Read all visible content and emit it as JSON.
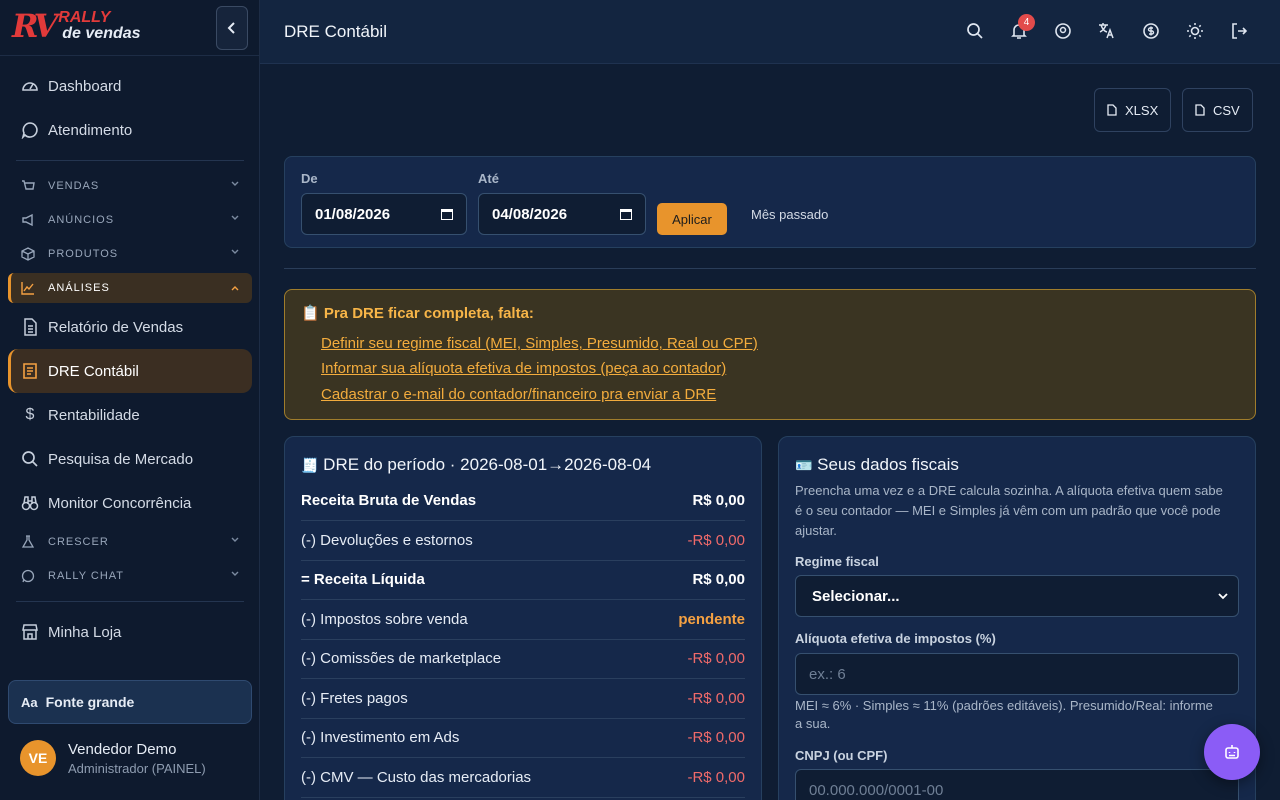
{
  "brand": {
    "mark": "RV",
    "line1": "RALLY",
    "line2": "de vendas",
    "accent": "#e23a3a"
  },
  "sidebar": {
    "top_items": [
      {
        "label": "Dashboard",
        "icon": "gauge-icon"
      },
      {
        "label": "Atendimento",
        "icon": "chat-bubble-icon"
      }
    ],
    "sections": [
      {
        "label": "VENDAS",
        "icon": "cart-icon"
      },
      {
        "label": "ANÚNCIOS",
        "icon": "megaphone-icon"
      },
      {
        "label": "PRODUTOS",
        "icon": "box-icon"
      },
      {
        "label": "ANÁLISES",
        "icon": "chart-line-icon",
        "expanded": true
      }
    ],
    "analysis_items": [
      {
        "label": "Relatório de Vendas",
        "icon": "document-icon"
      },
      {
        "label": "DRE Contábil",
        "icon": "receipt-icon",
        "active": true
      },
      {
        "label": "Rentabilidade",
        "icon": "dollar-icon"
      },
      {
        "label": "Pesquisa de Mercado",
        "icon": "search-icon"
      },
      {
        "label": "Monitor Concorrência",
        "icon": "binoculars-icon"
      }
    ],
    "sections2": [
      {
        "label": "CRESCER",
        "icon": "flask-icon"
      },
      {
        "label": "RALLY CHAT",
        "icon": "whatsapp-icon"
      }
    ],
    "store_item": {
      "label": "Minha Loja",
      "icon": "store-icon"
    },
    "font_toggle": "Fonte grande",
    "font_toggle_icon": "Aa",
    "user": {
      "initials": "VE",
      "name": "Vendedor Demo",
      "role": "Administrador (PAINEL)"
    }
  },
  "header": {
    "title": "DRE Contábil",
    "notification_count": "4",
    "icons": [
      "search-icon",
      "bell-icon",
      "user-circle-icon",
      "translate-icon",
      "currency-icon",
      "sun-icon",
      "logout-icon"
    ]
  },
  "toolbar": {
    "xlsx": "XLSX",
    "csv": "CSV"
  },
  "filter": {
    "from_label": "De",
    "from_value": "01/08/2026",
    "to_label": "Até",
    "to_value": "04/08/2026",
    "apply": "Aplicar",
    "preset": "Mês passado"
  },
  "warning": {
    "title": "📋 Pra DRE ficar completa, falta:",
    "links": [
      "Definir seu regime fiscal (MEI, Simples, Presumido, Real ou CPF)",
      "Informar sua alíquota efetiva de impostos (peça ao contador)",
      "Cadastrar o e-mail do contador/financeiro pra enviar a DRE"
    ]
  },
  "dre": {
    "title": "DRE do período · 2026-08-01→2026-08-04",
    "rows": [
      {
        "label": "Receita Bruta de Vendas",
        "value": "R$ 0,00",
        "style": "bold"
      },
      {
        "label": "(-) Devoluções e estornos",
        "value": "-R$ 0,00",
        "style": "neg"
      },
      {
        "label": "= Receita Líquida",
        "value": "R$ 0,00",
        "style": "bold"
      },
      {
        "label": "(-) Impostos sobre venda",
        "value": "pendente",
        "style": "pend"
      },
      {
        "label": "(-) Comissões de marketplace",
        "value": "-R$ 0,00",
        "style": "neg"
      },
      {
        "label": "(-) Fretes pagos",
        "value": "-R$ 0,00",
        "style": "neg"
      },
      {
        "label": "(-) Investimento em Ads",
        "value": "-R$ 0,00",
        "style": "neg"
      },
      {
        "label": "(-) CMV — Custo das mercadorias",
        "value": "-R$ 0,00",
        "style": "neg"
      }
    ]
  },
  "fiscal": {
    "title": "Seus dados fiscais",
    "description": "Preencha uma vez e a DRE calcula sozinha. A alíquota efetiva quem sabe é o seu contador — MEI e Simples já vêm com um padrão que você pode ajustar.",
    "regime_label": "Regime fiscal",
    "regime_value": "Selecionar...",
    "aliquota_label": "Alíquota efetiva de impostos (%)",
    "aliquota_placeholder": "ex.: 6",
    "aliquota_help": "MEI ≈ 6% · Simples ≈ 11% (padrões editáveis). Presumido/Real: informe a sua.",
    "cnpj_label": "CNPJ (ou CPF)",
    "cnpj_placeholder": "00.000.000/0001-00"
  },
  "colors": {
    "accent": "#e8942c",
    "negative": "#f06a6a",
    "fab": "#8b5cf6"
  }
}
